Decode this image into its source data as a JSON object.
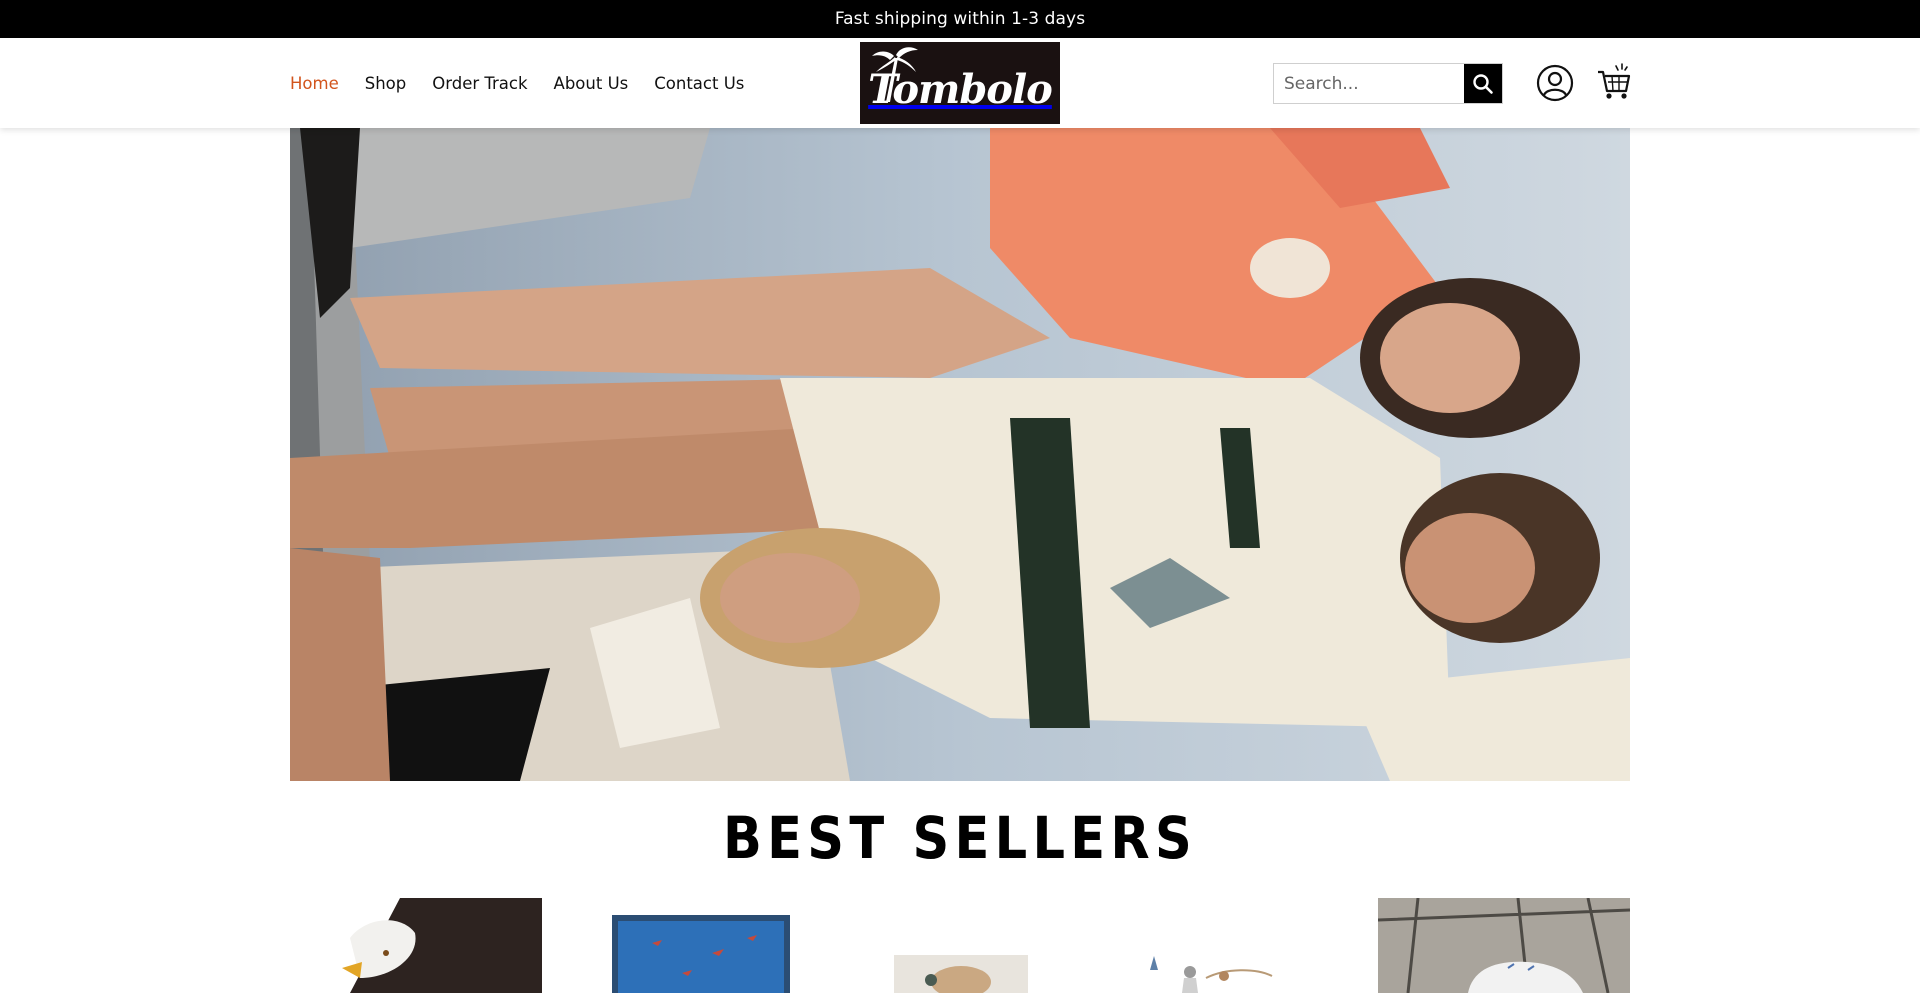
{
  "announcement": {
    "text": "Fast shipping within 1-3 days"
  },
  "nav": {
    "items": [
      {
        "label": "Home",
        "active": true
      },
      {
        "label": "Shop",
        "active": false
      },
      {
        "label": "Order Track",
        "active": false
      },
      {
        "label": "About Us",
        "active": false
      },
      {
        "label": "Contact Us",
        "active": false
      }
    ]
  },
  "logo": {
    "text": "Tombolo"
  },
  "search": {
    "placeholder": "Search..."
  },
  "icons": {
    "search": "search-icon",
    "account": "user-circle-icon",
    "cart": "shopping-cart-icon"
  },
  "colors": {
    "accent": "#d2541c",
    "announcement_bg": "#000000",
    "search_button": "#000000"
  },
  "best_sellers": {
    "title": "BEST SELLERS",
    "products": [
      {
        "image": "bald-eagle-shirt"
      },
      {
        "image": "blue-fish-print-shirt"
      },
      {
        "image": "beige-printed-shirt"
      },
      {
        "image": "fishing-scene-shirt"
      },
      {
        "image": "white-shirt-on-hanger"
      }
    ]
  }
}
